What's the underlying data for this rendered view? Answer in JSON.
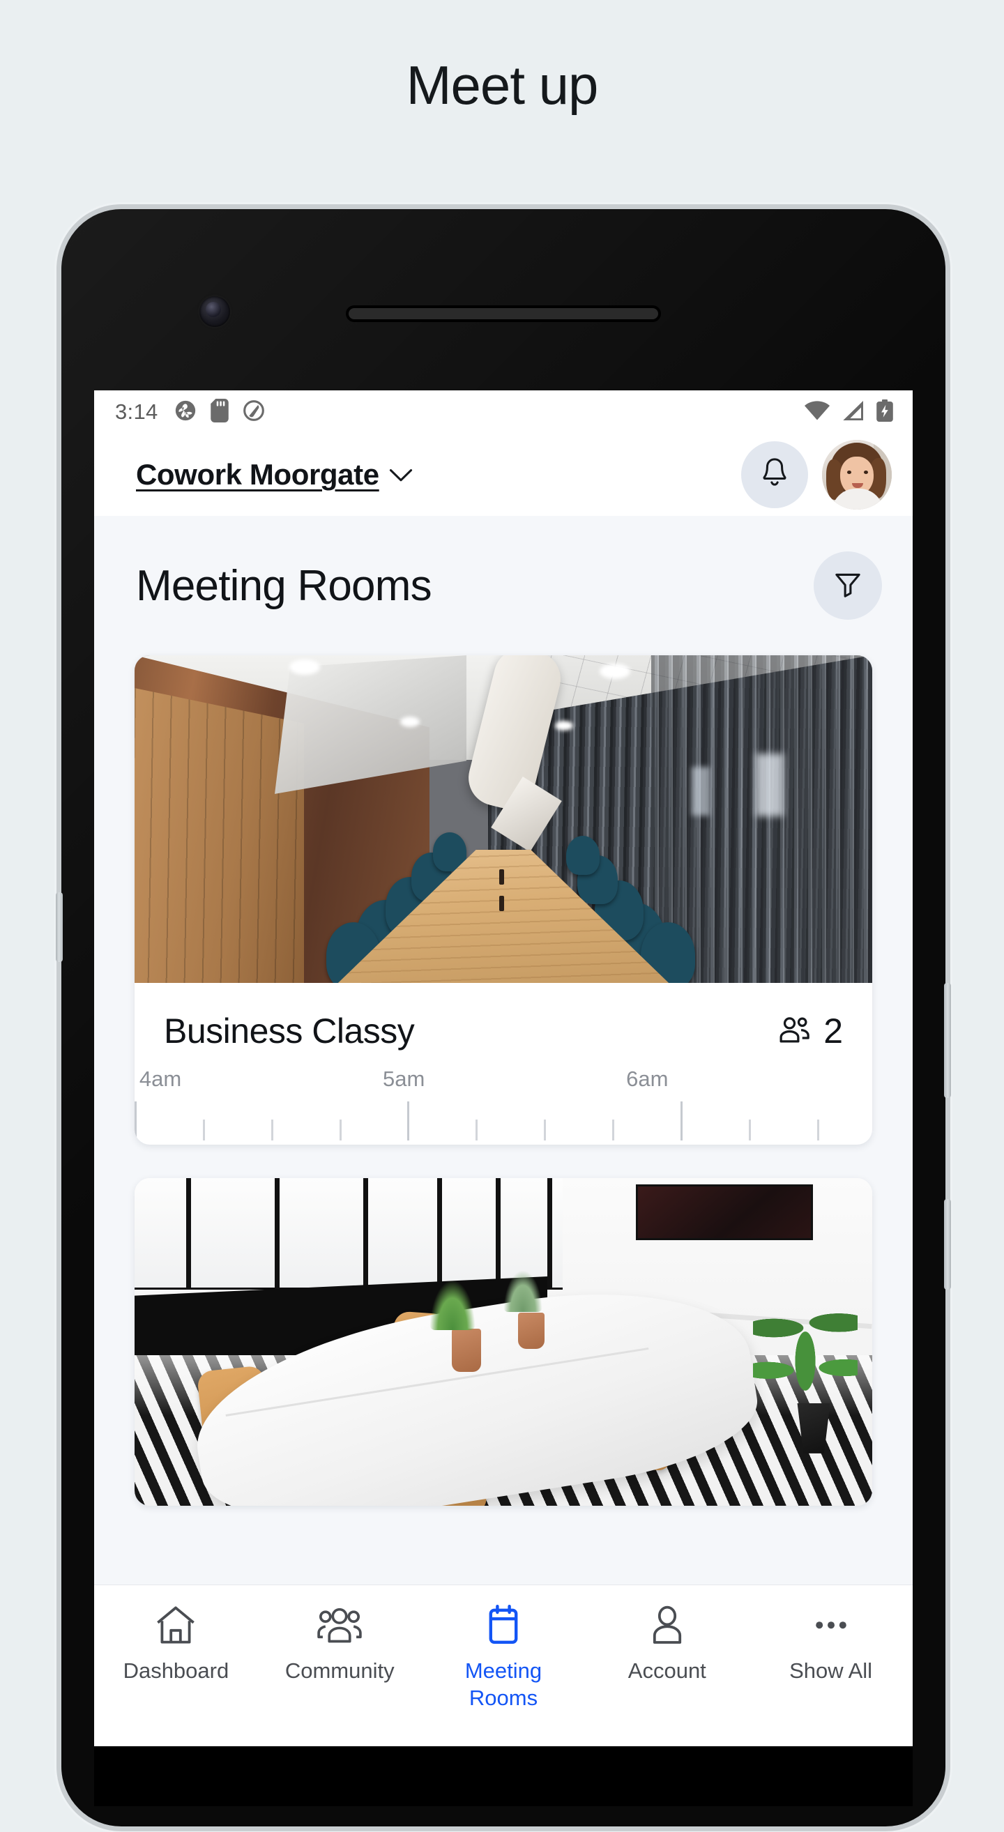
{
  "page": {
    "title": "Meet up",
    "background_color": "#eaeff1"
  },
  "status_bar": {
    "time": "3:14",
    "left_icons": [
      "camera-shutter-icon",
      "sd-card-icon",
      "sync-circle-icon"
    ],
    "right_icons": [
      "wifi-icon",
      "cellular-signal-icon",
      "battery-charging-icon"
    ]
  },
  "app_bar": {
    "location_name": "Cowork Moorgate",
    "location_chevron": "chevron-down-icon",
    "notification_icon": "bell-icon",
    "avatar": "user-avatar"
  },
  "page_head": {
    "section_title": "Meeting Rooms",
    "filter_icon": "filter-funnel-icon"
  },
  "rooms": [
    {
      "name": "Business Classy",
      "capacity": "2",
      "capacity_icon": "people-icon",
      "photo": "dark-conference-room",
      "timeline": {
        "hour_labels": [
          "4am",
          "5am",
          "6am"
        ],
        "hour_positions_pct": [
          0,
          37,
          74
        ],
        "minor_ticks_per_hour": 4
      }
    },
    {
      "name": "",
      "capacity": "",
      "photo": "white-meeting-room"
    }
  ],
  "bottom_nav": {
    "active_index": 2,
    "accent_color": "#1355f5",
    "items": [
      {
        "label": "Dashboard",
        "icon": "home-icon"
      },
      {
        "label": "Community",
        "icon": "people-group-icon"
      },
      {
        "label": "Meeting\nRooms",
        "label_line1": "Meeting",
        "label_line2": "Rooms",
        "icon": "calendar-icon"
      },
      {
        "label": "Account",
        "icon": "person-icon"
      },
      {
        "label": "Show All",
        "icon": "ellipsis-icon"
      }
    ]
  }
}
